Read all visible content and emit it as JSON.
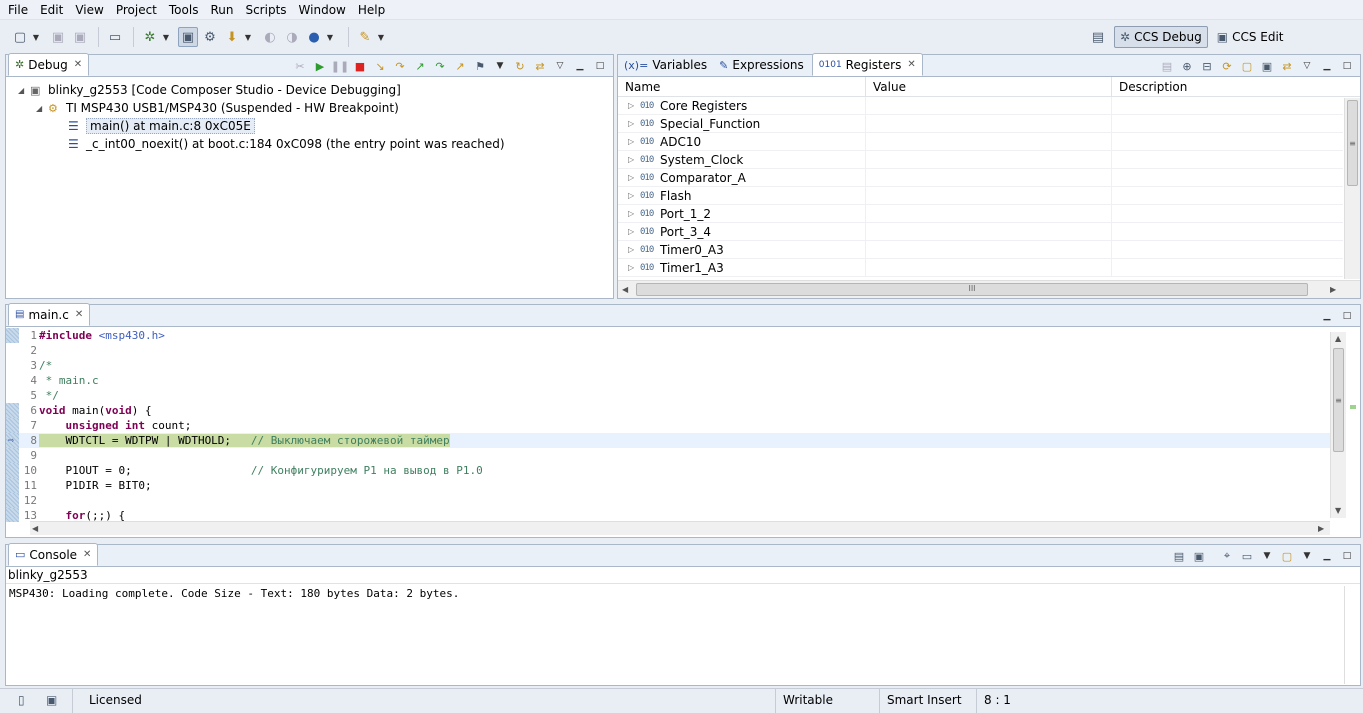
{
  "menu": [
    "File",
    "Edit",
    "View",
    "Project",
    "Tools",
    "Run",
    "Scripts",
    "Window",
    "Help"
  ],
  "perspectives": {
    "debug": "CCS Debug",
    "edit": "CCS Edit"
  },
  "debug_view": {
    "tab": "Debug",
    "items": [
      {
        "label": "blinky_g2553 [Code Composer Studio - Device Debugging]"
      },
      {
        "label": "TI MSP430 USB1/MSP430 (Suspended - HW Breakpoint)"
      },
      {
        "label": "main() at main.c:8 0xC05E"
      },
      {
        "label": "_c_int00_noexit() at boot.c:184 0xC098  (the entry point was reached)"
      }
    ]
  },
  "registers_view": {
    "tabs": [
      "Variables",
      "Expressions",
      "Registers"
    ],
    "columns": [
      "Name",
      "Value",
      "Description"
    ],
    "rows": [
      "Core Registers",
      "Special_Function",
      "ADC10",
      "System_Clock",
      "Comparator_A",
      "Flash",
      "Port_1_2",
      "Port_3_4",
      "Timer0_A3",
      "Timer1_A3"
    ],
    "hscroll_marker": "III"
  },
  "editor": {
    "tab": "main.c",
    "lines": [
      {
        "n": "1",
        "t": "#include <msp430.h>"
      },
      {
        "n": "2",
        "t": ""
      },
      {
        "n": "3",
        "t": "/*"
      },
      {
        "n": "4",
        "t": " * main.c"
      },
      {
        "n": "5",
        "t": " */"
      },
      {
        "n": "6",
        "t": "void main(void) {"
      },
      {
        "n": "7",
        "t": "    unsigned int count;"
      },
      {
        "n": "8",
        "t": "    WDTCTL = WDTPW | WDTHOLD;   // Выключаем сторожевой таймер"
      },
      {
        "n": "9",
        "t": ""
      },
      {
        "n": "10",
        "t": "    P1OUT = 0;                  // Конфигурируем P1 на вывод в P1.0"
      },
      {
        "n": "11",
        "t": "    P1DIR = BIT0;"
      },
      {
        "n": "12",
        "t": ""
      },
      {
        "n": "13",
        "t": "    for(;;) {"
      }
    ]
  },
  "console": {
    "tab": "Console",
    "label": "blinky_g2553",
    "output": "MSP430: Loading complete. Code Size - Text: 180 bytes Data: 2 bytes."
  },
  "status": {
    "license": "Licensed",
    "writable": "Writable",
    "insert_mode": "Smart Insert",
    "position": "8 : 1"
  }
}
